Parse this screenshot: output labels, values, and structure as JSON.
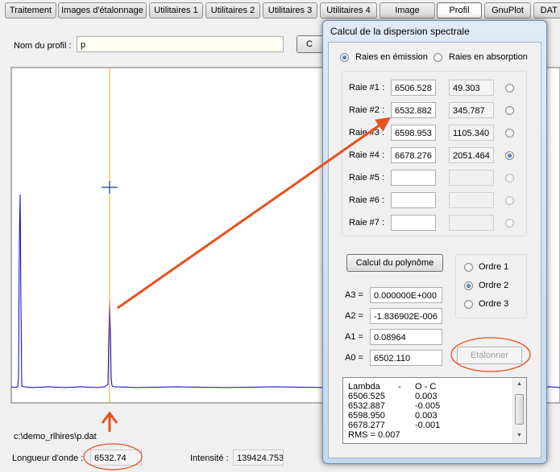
{
  "tabs": [
    {
      "label": "Traitement"
    },
    {
      "label": "Images d'étalonnage"
    },
    {
      "label": "Utilitaires 1"
    },
    {
      "label": "Utilitaires 2"
    },
    {
      "label": "Utilitaires 3"
    },
    {
      "label": "Utilitaires 4"
    },
    {
      "label": "Image"
    },
    {
      "label": "Profil"
    },
    {
      "label": "GnuPlot"
    },
    {
      "label": "DAT -"
    }
  ],
  "active_tab": "Profil",
  "profile": {
    "name_label": "Nom du profil :",
    "name_value": "p",
    "file_path": "c:\\demo_rlhires\\p.dat",
    "wavelength_label": "Longueur d'onde :",
    "wavelength_value": "6532.74",
    "intensity_label": "Intensité :",
    "intensity_value": "139424.753"
  },
  "dialog": {
    "title": "Calcul de la dispersion spectrale",
    "mode_emission": "Raies en émission",
    "mode_absorption": "Raies en absorption",
    "mode_selected": "emission",
    "lines": [
      {
        "label": "Raie #1 :",
        "wavelength": "6506.528",
        "pixel": "49.303",
        "selected": false
      },
      {
        "label": "Raie #2 :",
        "wavelength": "6532.882",
        "pixel": "345.787",
        "selected": false
      },
      {
        "label": "Raie #3 :",
        "wavelength": "6598.953",
        "pixel": "1105.340",
        "selected": false
      },
      {
        "label": "Raie #4 :",
        "wavelength": "6678.276",
        "pixel": "2051.464",
        "selected": true
      },
      {
        "label": "Raie #5 :",
        "wavelength": "",
        "pixel": "",
        "selected": false
      },
      {
        "label": "Raie #6 :",
        "wavelength": "",
        "pixel": "",
        "selected": false
      },
      {
        "label": "Raie #7 :",
        "wavelength": "",
        "pixel": "",
        "selected": false
      }
    ],
    "calc_button": "Calcul du polynôme",
    "orders": [
      {
        "label": "Ordre 1",
        "selected": false
      },
      {
        "label": "Ordre 2",
        "selected": true
      },
      {
        "label": "Ordre 3",
        "selected": false
      }
    ],
    "coefficients": [
      {
        "label": "A3 =",
        "value": "0.000000E+000"
      },
      {
        "label": "A2 =",
        "value": "-1.836902E-006"
      },
      {
        "label": "A1 =",
        "value": "0.08964"
      },
      {
        "label": "A0 =",
        "value": "6502.110"
      }
    ],
    "calibrate_button": "Etalonner",
    "results": {
      "header_lambda": "Lambda",
      "header_sep": "-",
      "header_oc": "O - C",
      "rows": [
        {
          "lambda": "6506.525",
          "oc": "0.003"
        },
        {
          "lambda": "6532.887",
          "oc": "-0.005"
        },
        {
          "lambda": "6598.950",
          "oc": "0.003"
        },
        {
          "lambda": "6678.277",
          "oc": "-0.001"
        }
      ],
      "rms": "RMS = 0.007"
    }
  },
  "colors": {
    "annotation": "#e8501e",
    "cursor_line": "#f5a623",
    "plot_line": "#0000cc",
    "dialog_frame": "#c3d6ea"
  }
}
